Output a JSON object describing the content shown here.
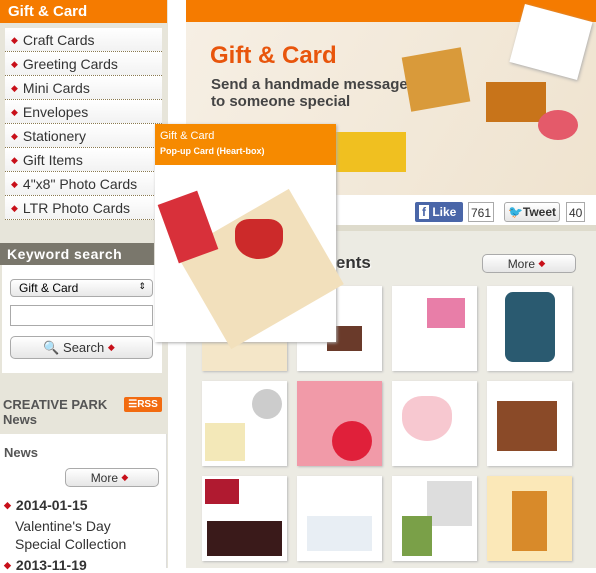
{
  "sidebar": {
    "title": "Gift & Card",
    "items": [
      "Craft Cards",
      "Greeting Cards",
      "Mini Cards",
      "Envelopes",
      "Stationery",
      "Gift Items",
      "4\"x8\" Photo Cards",
      "LTR Photo Cards"
    ]
  },
  "search": {
    "title": "Keyword search",
    "category": "Gift & Card",
    "input_value": "",
    "button": "Search"
  },
  "news": {
    "title_line1": "CREATIVE PARK",
    "title_line2": "News",
    "rss": "RSS",
    "label": "News",
    "more": "More",
    "items": [
      {
        "date": "2014-01-15",
        "text": "Valentine's Day Special Collection"
      },
      {
        "date": "2013-11-19",
        "text": ""
      }
    ]
  },
  "banner": {
    "title": "Gift & Card",
    "line1": "Send a handmade message",
    "line2": "to someone special"
  },
  "social": {
    "like": "Like",
    "like_count": "761",
    "tweet": "Tweet",
    "tweet_count": "40"
  },
  "contents": {
    "heading": "contents",
    "more": "More"
  },
  "popup": {
    "title": "Gift & Card",
    "subtitle": "Pop-up Card (Heart-box)"
  },
  "colors": {
    "accent": "#f57b00",
    "arrow": "#c8101a"
  }
}
